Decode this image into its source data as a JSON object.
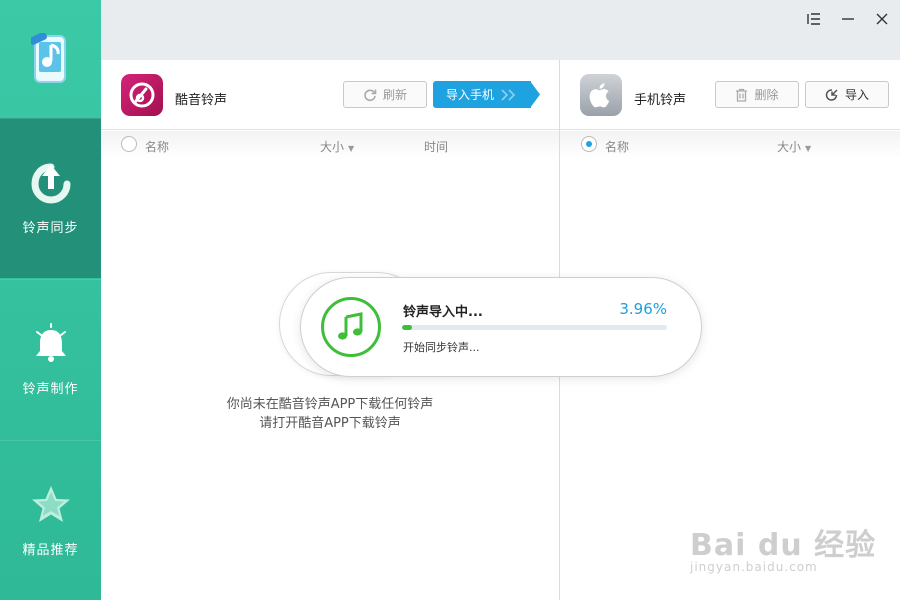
{
  "sidebar": {
    "items": [
      {
        "label": "铃声同步",
        "icon": "sync-upload-icon",
        "active": true
      },
      {
        "label": "铃声制作",
        "icon": "bell-icon",
        "active": false
      },
      {
        "label": "精品推荐",
        "icon": "star-icon",
        "active": false
      }
    ]
  },
  "window": {
    "controls": [
      "menu-icon",
      "minimize-icon",
      "close-icon"
    ]
  },
  "left_panel": {
    "title": "酷音铃声",
    "refresh_label": "刷新",
    "import_phone_label": "导入手机",
    "columns": {
      "name": "名称",
      "size": "大小",
      "time": "时间"
    },
    "empty_line1": "你尚未在酷音铃声APP下载任何铃声",
    "empty_line2": "请打开酷音APP下载铃声"
  },
  "right_panel": {
    "title": "手机铃声",
    "delete_label": "删除",
    "import_label": "导入",
    "columns": {
      "name": "名称",
      "size": "大小"
    }
  },
  "progress_dialog": {
    "title": "铃声导入中...",
    "percent_text": "3.96%",
    "progress": 0.0396,
    "status": "开始同步铃声..."
  },
  "watermark": {
    "main": "Bai du 经验",
    "sub": "jingyan.baidu.com"
  },
  "colors": {
    "sidebar": "#3bc9a6",
    "sidebar_active": "#239179",
    "accent_blue": "#1fa3e0",
    "accent_green": "#3fbe3a"
  }
}
